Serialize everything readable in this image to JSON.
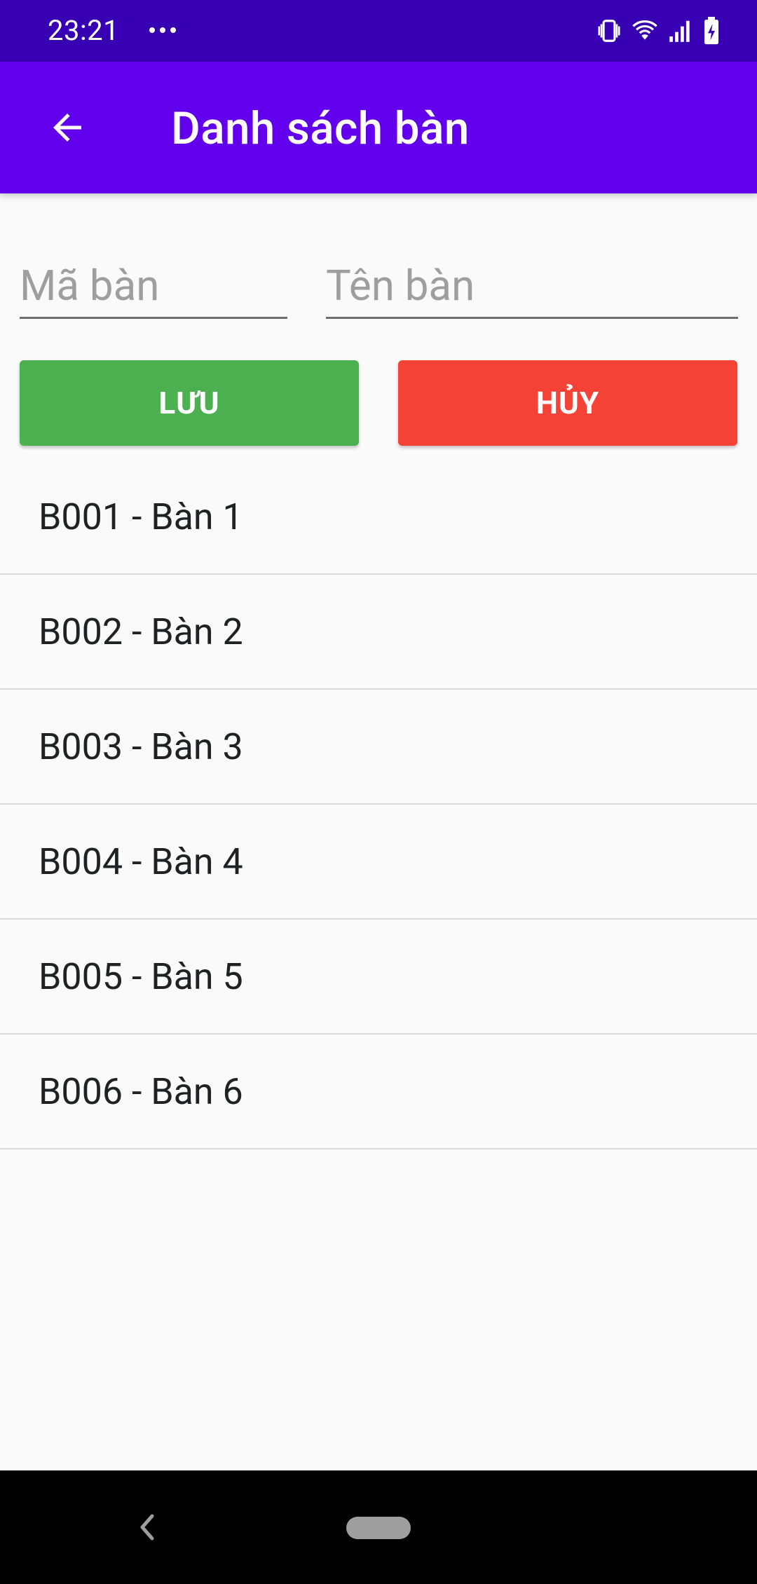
{
  "status_bar": {
    "time": "23:21",
    "icons": [
      "dots-icon",
      "vibrate-icon",
      "wifi-icon",
      "signal-icon",
      "battery-icon"
    ]
  },
  "app_bar": {
    "title": "Danh sách bàn",
    "back_icon": "arrow-left-icon"
  },
  "form": {
    "ma_ban_placeholder": "Mã bàn",
    "ten_ban_placeholder": "Tên bàn",
    "ma_ban_value": "",
    "ten_ban_value": "",
    "save_label": "LƯU",
    "cancel_label": "HỦY"
  },
  "tables": [
    {
      "label": "B001 - Bàn 1"
    },
    {
      "label": "B002 - Bàn 2"
    },
    {
      "label": "B003 - Bàn 3"
    },
    {
      "label": "B004 - Bàn 4"
    },
    {
      "label": "B005 - Bàn 5"
    },
    {
      "label": "B006 - Bàn 6"
    }
  ],
  "colors": {
    "status_bar": "#3700B3",
    "app_bar": "#6200EE",
    "save_button": "#4CAF50",
    "cancel_button": "#F44336",
    "background": "#FAFAFA",
    "nav_bar": "#000000"
  }
}
